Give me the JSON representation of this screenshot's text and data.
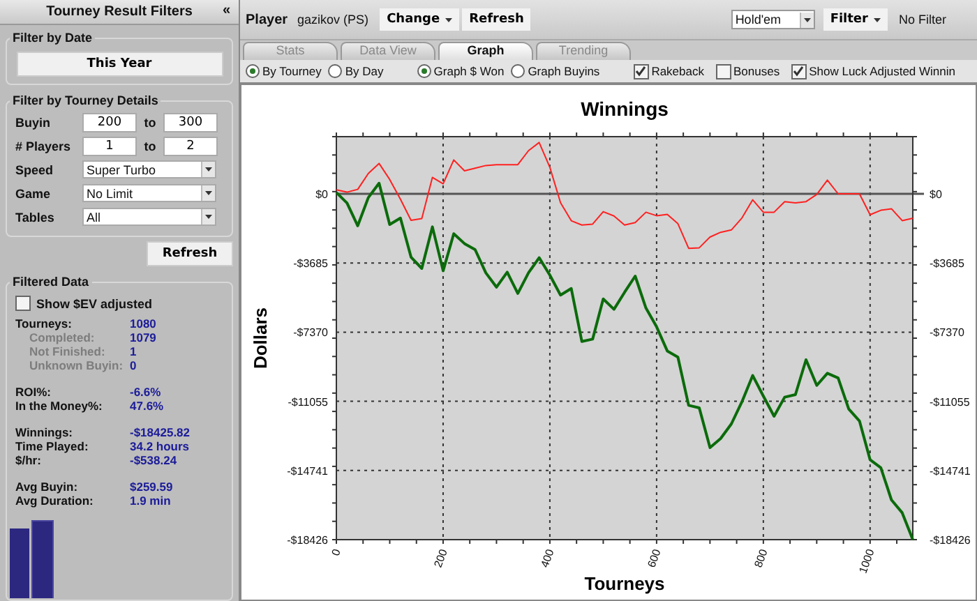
{
  "sidebar": {
    "title": "Tourney Result Filters",
    "collapse": "«",
    "date_filter": {
      "heading": "Filter by Date",
      "button": "This Year"
    },
    "details_filter": {
      "heading": "Filter by Tourney Details",
      "rows": [
        {
          "kind": "range",
          "label": "Buyin",
          "from": "200",
          "to_label": "to",
          "to": "300"
        },
        {
          "kind": "range",
          "label": "# Players",
          "from": "1",
          "to_label": "to",
          "to": "2"
        },
        {
          "kind": "select",
          "label": "Speed",
          "value": "Super Turbo"
        },
        {
          "kind": "select",
          "label": "Game",
          "value": "No Limit"
        },
        {
          "kind": "select",
          "label": "Tables",
          "value": "All"
        }
      ],
      "refresh": "Refresh"
    },
    "filtered_data": {
      "heading": "Filtered Data",
      "ev_checkbox": {
        "label": "Show $EV adjusted",
        "checked": false
      },
      "groups": [
        [
          {
            "kind": "main",
            "label": "Tourneys:",
            "value": "1080"
          },
          {
            "kind": "sub",
            "label": "Completed:",
            "value": "1079"
          },
          {
            "kind": "sub",
            "label": "Not Finished:",
            "value": "1"
          },
          {
            "kind": "sub",
            "label": "Unknown Buyin:",
            "value": "0"
          }
        ],
        [
          {
            "kind": "main",
            "label": "ROI%:",
            "value": "-6.6%"
          },
          {
            "kind": "main",
            "label": "In the Money%:",
            "value": "47.6%"
          }
        ],
        [
          {
            "kind": "main",
            "label": "Winnings:",
            "value": "-$18425.82"
          },
          {
            "kind": "main",
            "label": "Time Played:",
            "value": "34.2 hours"
          },
          {
            "kind": "main",
            "label": "$/hr:",
            "value": "-$538.24"
          }
        ],
        [
          {
            "kind": "main",
            "label": "Avg Buyin:",
            "value": "$259.59"
          },
          {
            "kind": "main",
            "label": "Avg Duration:",
            "value": "1.9 min"
          }
        ]
      ]
    }
  },
  "toolbar": {
    "player_label": "Player",
    "player_name": "gazikov (PS)",
    "change_button": "Change",
    "refresh_button": "Refresh",
    "game_select": "Hold'em",
    "filter_button": "Filter",
    "filter_status": "No Filter"
  },
  "tabs": [
    {
      "label": "Stats",
      "selected": false
    },
    {
      "label": "Data View",
      "selected": false
    },
    {
      "label": "Graph",
      "selected": true
    },
    {
      "label": "Trending",
      "selected": false
    }
  ],
  "options": {
    "radio_groups": [
      [
        {
          "label": "By Tourney",
          "selected": true
        },
        {
          "label": "By Day",
          "selected": false
        }
      ],
      [
        {
          "label": "Graph $ Won",
          "selected": true
        },
        {
          "label": "Graph Buyins",
          "selected": false
        }
      ]
    ],
    "checkboxes": [
      {
        "label": "Rakeback",
        "checked": true
      },
      {
        "label": "Bonuses",
        "checked": false
      },
      {
        "label": "Show Luck Adjusted Winnin",
        "checked": true
      }
    ]
  },
  "chart_data": {
    "type": "line",
    "title": "Winnings",
    "xlabel": "Tourneys",
    "ylabel": "Dollars",
    "x": [
      0,
      20,
      40,
      60,
      80,
      100,
      120,
      140,
      160,
      180,
      200,
      220,
      240,
      260,
      280,
      300,
      320,
      340,
      360,
      380,
      400,
      420,
      440,
      460,
      480,
      500,
      520,
      540,
      560,
      580,
      600,
      620,
      640,
      660,
      680,
      700,
      720,
      740,
      760,
      780,
      800,
      820,
      840,
      860,
      880,
      900,
      920,
      940,
      960,
      980,
      1000,
      1020,
      1040,
      1060,
      1080
    ],
    "series": [
      {
        "color": "#ff2020",
        "values": [
          220,
          90,
          240,
          1090,
          1620,
          770,
          -290,
          -1410,
          -1320,
          880,
          540,
          1810,
          1230,
          1370,
          1510,
          1560,
          1560,
          1560,
          2310,
          2740,
          1410,
          -470,
          -1430,
          -1660,
          -1610,
          -950,
          -1180,
          -1660,
          -1530,
          -980,
          -1160,
          -1100,
          -1590,
          -2900,
          -2870,
          -2300,
          -2050,
          -1920,
          -1280,
          -320,
          -980,
          -980,
          -410,
          -480,
          -410,
          -30,
          730,
          0,
          0,
          0,
          -1110,
          -870,
          -790,
          -1420,
          -1300
        ]
      },
      {
        "color": "#0b6b0b",
        "values": [
          70,
          -490,
          -1700,
          -200,
          570,
          -1630,
          -1290,
          -3370,
          -3970,
          -1760,
          -4100,
          -2120,
          -2650,
          -2970,
          -4210,
          -4970,
          -4170,
          -5300,
          -4200,
          -3400,
          -4340,
          -5390,
          -5040,
          -7870,
          -7740,
          -5600,
          -6150,
          -5240,
          -4380,
          -6080,
          -7080,
          -8370,
          -8700,
          -11270,
          -11400,
          -13520,
          -13040,
          -12260,
          -11080,
          -9680,
          -10770,
          -11850,
          -10830,
          -10700,
          -8840,
          -10210,
          -9560,
          -9810,
          -11460,
          -12100,
          -14170,
          -14590,
          -16310,
          -16990,
          -18426
        ]
      }
    ],
    "grid": true,
    "xlim": [
      0,
      1080
    ],
    "ylim": [
      -18426,
      3050
    ],
    "xticks": [
      0,
      200,
      400,
      600,
      800,
      1000
    ],
    "yticks": [
      {
        "value": 0,
        "label": "$0"
      },
      {
        "value": -3685,
        "label": "-$3685"
      },
      {
        "value": -7370,
        "label": "-$7370"
      },
      {
        "value": -11055,
        "label": "-$11055"
      },
      {
        "value": -14741,
        "label": "-$14741"
      },
      {
        "value": -18426,
        "label": "-$18426"
      }
    ]
  }
}
